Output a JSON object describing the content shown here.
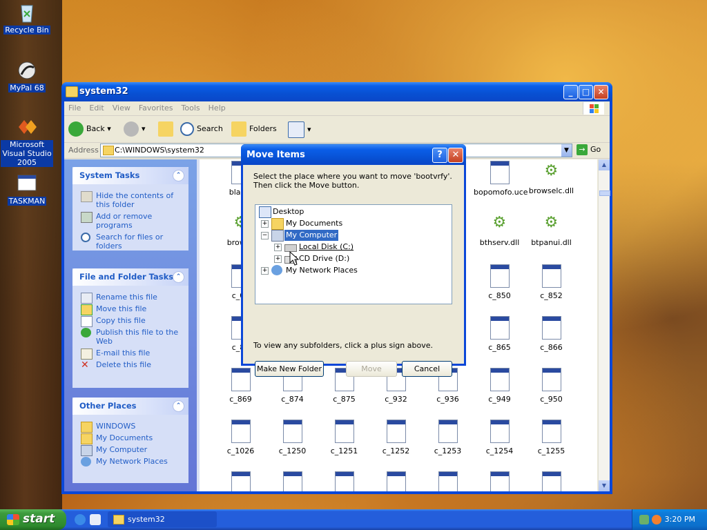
{
  "desktop": {
    "icons": [
      {
        "label": "Recycle Bin"
      },
      {
        "label": "MyPal 68"
      },
      {
        "label": "Microsoft Visual Studio 2005"
      },
      {
        "label": "TASKMAN"
      }
    ]
  },
  "explorer": {
    "title": "system32",
    "menu": [
      "File",
      "Edit",
      "View",
      "Favorites",
      "Tools",
      "Help"
    ],
    "toolbar": {
      "back": "Back",
      "search": "Search",
      "folders": "Folders"
    },
    "address": {
      "label": "Address",
      "value": "C:\\WINDOWS\\system32",
      "go": "Go"
    },
    "system_tasks": {
      "title": "System Tasks",
      "items": [
        "Hide the contents of this folder",
        "Add or remove programs",
        "Search for files or folders"
      ]
    },
    "file_tasks": {
      "title": "File and Folder Tasks",
      "items": [
        "Rename this file",
        "Move this file",
        "Copy this file",
        "Publish this file to the Web",
        "E-mail this file",
        "Delete this file"
      ]
    },
    "other_places": {
      "title": "Other Places",
      "items": [
        "WINDOWS",
        "My Documents",
        "My Computer",
        "My Network Places"
      ]
    },
    "files": [
      {
        "name": "blasto",
        "type": "exe"
      },
      {
        "name": "bopomofo.uce",
        "type": "exe"
      },
      {
        "name": "browselc.dll",
        "type": "dll"
      },
      {
        "name": "browse",
        "type": "dll"
      },
      {
        "name": "bthserv.dll",
        "type": "dll"
      },
      {
        "name": "btpanui.dll",
        "type": "dll"
      },
      {
        "name": "c_03",
        "type": "exe"
      },
      {
        "name": "c_850",
        "type": "exe"
      },
      {
        "name": "c_852",
        "type": "exe"
      },
      {
        "name": "c_85",
        "type": "exe"
      },
      {
        "name": "c_865",
        "type": "exe"
      },
      {
        "name": "c_866",
        "type": "exe"
      },
      {
        "name": "c_869",
        "type": "exe"
      },
      {
        "name": "c_874",
        "type": "exe"
      },
      {
        "name": "c_875",
        "type": "exe"
      },
      {
        "name": "c_932",
        "type": "exe"
      },
      {
        "name": "c_936",
        "type": "exe"
      },
      {
        "name": "c_949",
        "type": "exe"
      },
      {
        "name": "c_950",
        "type": "exe"
      },
      {
        "name": "c_1026",
        "type": "exe"
      },
      {
        "name": "c_1250",
        "type": "exe"
      },
      {
        "name": "c_1251",
        "type": "exe"
      },
      {
        "name": "c_1252",
        "type": "exe"
      },
      {
        "name": "c_1253",
        "type": "exe"
      },
      {
        "name": "c_1254",
        "type": "exe"
      },
      {
        "name": "c_1255",
        "type": "exe"
      }
    ]
  },
  "dialog": {
    "title": "Move Items",
    "message": "Select the place where you want to move 'bootvrfy'. Then click the Move button.",
    "tree": {
      "desktop": "Desktop",
      "my_documents": "My Documents",
      "my_computer": "My Computer",
      "local_disk": "Local Disk (C:)",
      "cd_drive": "CD Drive (D:)",
      "network": "My Network Places"
    },
    "hint": "To view any subfolders, click a plus sign above.",
    "buttons": {
      "new_folder": "Make New Folder",
      "move": "Move",
      "cancel": "Cancel"
    }
  },
  "taskbar": {
    "start": "start",
    "task": "system32",
    "clock": "3:20 PM"
  }
}
